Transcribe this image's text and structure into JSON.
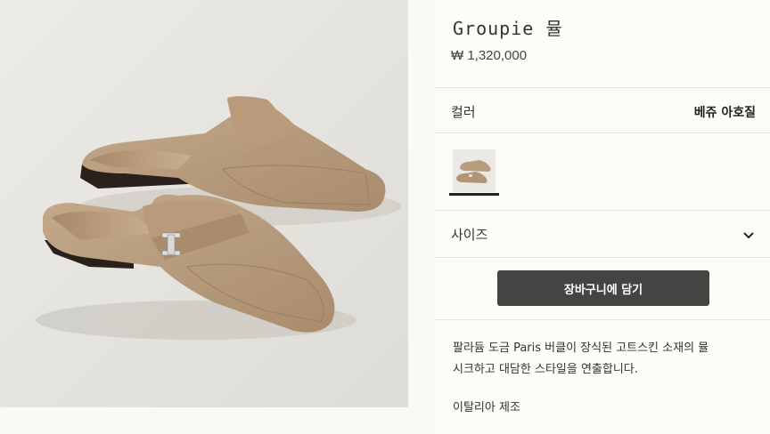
{
  "product": {
    "name": "Groupie 뮬",
    "price": "₩ 1,320,000"
  },
  "color": {
    "label": "컬러",
    "value": "베쥬 아호질"
  },
  "size": {
    "label": "사이즈"
  },
  "cart": {
    "button_label": "장바구니에 담기"
  },
  "description": {
    "line1": "팔라듐 도금 Paris 버클이 장식된 고트스킨 소재의 뮬",
    "line2": "시크하고 대담한 스타일을 연출합니다.",
    "origin": "이탈리아 제조"
  },
  "colors": {
    "accent": "#444443",
    "background": "#fbf9f5",
    "image_bg": "#e9e8e3",
    "shoe": "#b89c7e"
  },
  "icons": {
    "size_toggle": "chevron-down-icon"
  }
}
